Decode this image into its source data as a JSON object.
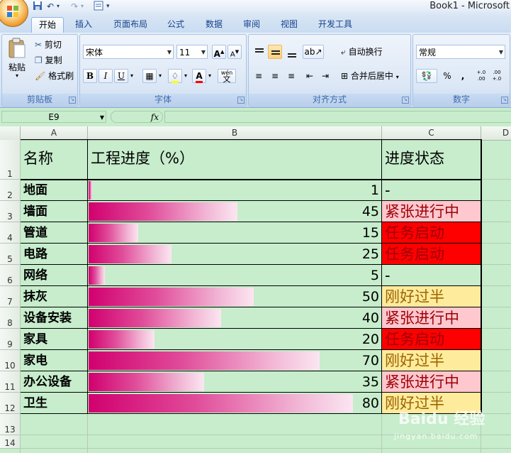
{
  "window": {
    "title": "Book1 - Microsoft"
  },
  "tabs": [
    "开始",
    "插入",
    "页面布局",
    "公式",
    "数据",
    "审阅",
    "视图",
    "开发工具"
  ],
  "ribbon": {
    "clipboard": {
      "group_label": "剪贴板",
      "paste": "粘贴",
      "cut": "剪切",
      "copy": "复制",
      "format_painter": "格式刷"
    },
    "font": {
      "group_label": "字体",
      "font_name": "宋体",
      "font_size": "11",
      "bold": "B",
      "italic": "I",
      "underline": "U",
      "grow": "A",
      "shrink": "A",
      "font_color": "A",
      "phonetic": "wén",
      "phonetic_char": "文"
    },
    "alignment": {
      "group_label": "对齐方式",
      "wrap_text": "自动换行",
      "merge_center": "合并后居中"
    },
    "number": {
      "group_label": "数字",
      "format": "常规",
      "percent": "%",
      "comma": ",",
      "inc_decimal": "+.0 .00",
      "dec_decimal": ".00 +.0"
    }
  },
  "formula_bar": {
    "name_box": "E9",
    "fx": "fx",
    "content": ""
  },
  "columns": [
    "A",
    "B",
    "C",
    "D"
  ],
  "row_numbers": [
    "1",
    "2",
    "3",
    "4",
    "5",
    "6",
    "7",
    "8",
    "9",
    "10",
    "11",
    "12",
    "13",
    "14"
  ],
  "sheet": {
    "header": {
      "name": "名称",
      "progress": "工程进度（%）",
      "status": "进度状态"
    },
    "rows": [
      {
        "name": "地面",
        "progress": 1,
        "status": "-",
        "status_bg": "#c7edcc",
        "status_color": "#000000"
      },
      {
        "name": "墙面",
        "progress": 45,
        "status": "紧张进行中",
        "status_bg": "#ffc7ce",
        "status_color": "#9c0006"
      },
      {
        "name": "管道",
        "progress": 15,
        "status": "任务启动",
        "status_bg": "#ff0000",
        "status_color": "#9c0006"
      },
      {
        "name": "电路",
        "progress": 25,
        "status": "任务启动",
        "status_bg": "#ff0000",
        "status_color": "#9c0006"
      },
      {
        "name": "网络",
        "progress": 5,
        "status": "-",
        "status_bg": "#c7edcc",
        "status_color": "#000000"
      },
      {
        "name": "抹灰",
        "progress": 50,
        "status": "刚好过半",
        "status_bg": "#ffeb9c",
        "status_color": "#9c6500"
      },
      {
        "name": "设备安装",
        "progress": 40,
        "status": "紧张进行中",
        "status_bg": "#ffc7ce",
        "status_color": "#9c0006"
      },
      {
        "name": "家具",
        "progress": 20,
        "status": "任务启动",
        "status_bg": "#ff0000",
        "status_color": "#9c0006"
      },
      {
        "name": "家电",
        "progress": 70,
        "status": "刚好过半",
        "status_bg": "#ffeb9c",
        "status_color": "#9c6500"
      },
      {
        "name": "办公设备",
        "progress": 35,
        "status": "紧张进行中",
        "status_bg": "#ffc7ce",
        "status_color": "#9c0006"
      },
      {
        "name": "卫生",
        "progress": 80,
        "status": "刚好过半",
        "status_bg": "#ffeb9c",
        "status_color": "#9c6500"
      }
    ],
    "databar_max": 80,
    "databar_colors": [
      "#d1006f",
      "#fbe6f1"
    ]
  },
  "watermark": {
    "brand": "Baidu 经验",
    "url": "jingyan.baidu.com"
  }
}
